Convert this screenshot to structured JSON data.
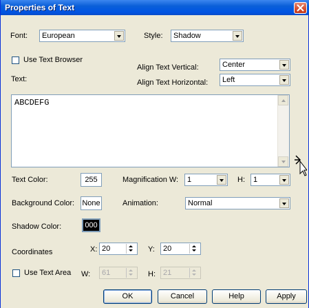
{
  "window": {
    "title": "Properties of Text"
  },
  "font": {
    "label": "Font:",
    "value": "European"
  },
  "style": {
    "label": "Style:",
    "value": "Shadow"
  },
  "use_text_browser": {
    "label": "Use Text Browser",
    "checked": false
  },
  "text_label": "Text:",
  "align_vertical": {
    "label": "Align Text Vertical:",
    "value": "Center"
  },
  "align_horizontal": {
    "label": "Align Text Horizontal:",
    "value": "Left"
  },
  "text_content": "ABCDEFG",
  "text_color": {
    "label": "Text Color:",
    "value": "255"
  },
  "magnification": {
    "label": "Magnification W:",
    "w": "1",
    "h_label": "H:",
    "h": "1"
  },
  "background_color": {
    "label": "Background Color:",
    "value": "None"
  },
  "animation": {
    "label": "Animation:",
    "value": "Normal"
  },
  "shadow_color": {
    "label": "Shadow Color:",
    "value": "000"
  },
  "coordinates": {
    "label": "Coordinates",
    "x_label": "X:",
    "x": "20",
    "y_label": "Y:",
    "y": "20"
  },
  "use_text_area": {
    "label": "Use Text Area",
    "checked": false,
    "w_label": "W:",
    "w": "61",
    "h_label": "H:",
    "h": "21"
  },
  "buttons": {
    "ok": "OK",
    "cancel": "Cancel",
    "help": "Help",
    "apply": "Apply"
  },
  "colors": {
    "title_bar": "#0054e3",
    "dialog_bg": "#ece9d8",
    "close": "#d44e2f"
  }
}
